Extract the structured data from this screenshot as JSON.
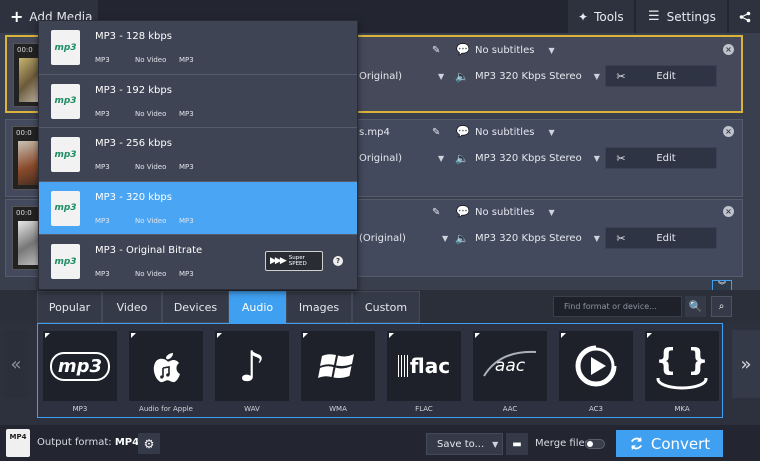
{
  "topbar": {
    "add_media": "Add Media",
    "tools": "Tools",
    "settings": "Settings"
  },
  "files": [
    {
      "time": "00:0",
      "subtitles": "No subtitles",
      "video_tail": "Original)",
      "audio": "MP3 320 Kbps Stereo",
      "edit": "Edit",
      "name_tail": ""
    },
    {
      "time": "00:0",
      "subtitles": "No subtitles",
      "video_tail": "Original)",
      "audio": "MP3 320 Kbps Stereo",
      "edit": "Edit",
      "name_tail": "s.mp4"
    },
    {
      "time": "00:0",
      "subtitles": "No subtitles",
      "video_tail": "(Original)",
      "audio": "MP3 320 Kbps Stereo",
      "edit": "Edit",
      "name_tail": ""
    }
  ],
  "presets": [
    {
      "title": "MP3 - 128 kbps",
      "codec": "MP3",
      "video": "No Video",
      "audio": "MP3",
      "icon_text": "mp3"
    },
    {
      "title": "MP3 - 192 kbps",
      "codec": "MP3",
      "video": "No Video",
      "audio": "MP3",
      "icon_text": "mp3"
    },
    {
      "title": "MP3 - 256 kbps",
      "codec": "MP3",
      "video": "No Video",
      "audio": "MP3",
      "icon_text": "mp3"
    },
    {
      "title": "MP3 - 320 kbps",
      "codec": "MP3",
      "video": "No Video",
      "audio": "MP3",
      "icon_text": "mp3",
      "selected": true
    },
    {
      "title": "MP3 - Original Bitrate",
      "codec": "MP3",
      "video": "No Video",
      "audio": "MP3",
      "icon_text": "mp3"
    }
  ],
  "superspeed": {
    "line1": "Super",
    "line2": "SPEED"
  },
  "tabs": [
    "Popular",
    "Video",
    "Devices",
    "Audio",
    "Images",
    "Custom"
  ],
  "active_tab": "Audio",
  "search": {
    "placeholder": "Find format or device..."
  },
  "formats": [
    {
      "label": "MP3",
      "icon": "mp3-icon",
      "glyph": "mp3"
    },
    {
      "label": "Audio for Apple",
      "icon": "apple-icon",
      "glyph": ""
    },
    {
      "label": "WAV",
      "icon": "music-note-icon",
      "glyph": "♪"
    },
    {
      "label": "WMA",
      "icon": "windows-icon",
      "glyph": ""
    },
    {
      "label": "FLAC",
      "icon": "flac-icon",
      "glyph": "flac"
    },
    {
      "label": "AAC",
      "icon": "aac-icon",
      "glyph": "aac"
    },
    {
      "label": "AC3",
      "icon": "ac3-play-icon",
      "glyph": ""
    },
    {
      "label": "MKA",
      "icon": "mka-braces-icon",
      "glyph": "{ }"
    }
  ],
  "bottom": {
    "output_label": "Output format:",
    "output_value": "MP4",
    "mp4_icon": "MP4",
    "save_to": "Save to...",
    "merge": "Merge files",
    "convert": "Convert"
  },
  "colors": {
    "accent": "#3f9ff0",
    "selected_border": "#d9b33a",
    "mp3_green": "#1c8c62"
  }
}
